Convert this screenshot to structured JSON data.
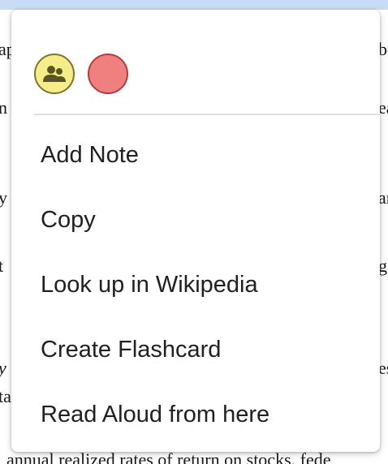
{
  "background_text": {
    "fragments": [
      "ap",
      "bo",
      "n",
      "ea",
      "y",
      "an",
      "t",
      "g",
      "y",
      "es",
      "ta"
    ],
    "bottom_line": "annual realized rates of return on stocks, fede"
  },
  "highlight_colors": [
    {
      "name": "shared-notes-icon",
      "color": "#f5ec8a"
    },
    {
      "name": "red-highlight",
      "color": "#f08080"
    }
  ],
  "menu": {
    "items": [
      {
        "label": "Add Note"
      },
      {
        "label": "Copy"
      },
      {
        "label": "Look up in Wikipedia"
      },
      {
        "label": "Create Flashcard"
      },
      {
        "label": "Read Aloud from here"
      }
    ]
  }
}
